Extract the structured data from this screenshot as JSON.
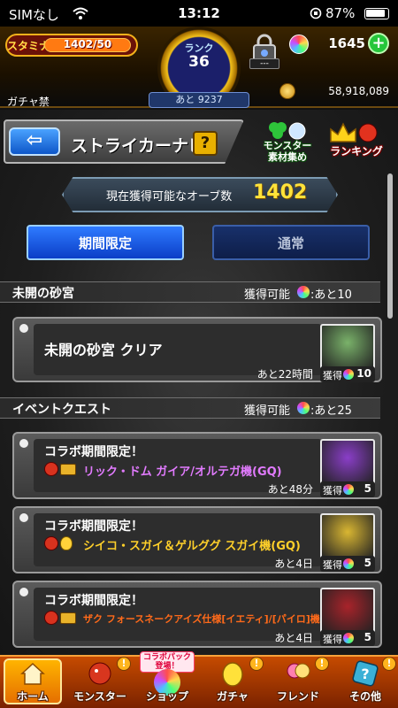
{
  "statusbar": {
    "carrier": "SIMなし",
    "time": "13:12",
    "battery": "87%"
  },
  "header": {
    "stamina_label": "スタミナ",
    "stamina_value": "1402/50",
    "stamina_fill": 1.0,
    "rank_label": "ランク",
    "rank_value": "36",
    "rank_next": "あと 9237",
    "lock_text": "---",
    "orb_count": "1645",
    "gacha_ban": "ガチャ禁",
    "coin_count": "58,918,089"
  },
  "title": {
    "text": "ストライカーナビ",
    "help": "?"
  },
  "shortcuts": {
    "monster_material": [
      "モンスター",
      "素材集め"
    ],
    "ranking": "ランキング"
  },
  "orb_banner": {
    "label": "現在獲得可能なオーブ数",
    "value": "1402"
  },
  "tabs": {
    "limited": "期間限定",
    "normal": "通常"
  },
  "sections": [
    {
      "title": "未開の砂宮",
      "available": "獲得可能",
      "remaining": ":あと10"
    },
    {
      "title": "イベントクエスト",
      "available": "獲得可能",
      "remaining": ":あと25"
    }
  ],
  "cards": [
    {
      "title": "未開の砂宮 クリア",
      "sub": "",
      "time": "あと22時間",
      "reward_label": "獲得",
      "reward": "10",
      "thumb_color": "#7ab26a"
    },
    {
      "title": "コラボ期間限定！",
      "sub": "リック・ドム ガイア/オルテガ機(GQ)",
      "time": "あと48分",
      "reward_label": "獲得",
      "reward": "5",
      "sub_color": "#e27bff",
      "thumb_color": "#8a3ec8"
    },
    {
      "title": "コラボ期間限定！",
      "sub": "シイコ・スガイ＆ゲルググ スガイ機(GQ)",
      "time": "あと4日",
      "reward_label": "獲得",
      "reward": "5",
      "sub_color": "#ffd02a",
      "thumb_color": "#d9b632"
    },
    {
      "title": "コラボ期間限定！",
      "sub": "ザク フォースネークアイズ仕様[イエティ]/[パイロ]機",
      "time": "あと4日",
      "reward_label": "獲得",
      "reward": "5",
      "sub_color": "#ff6a1a",
      "thumb_color": "#a8232a"
    }
  ],
  "nav": {
    "home": "ホーム",
    "monster": "モンスター",
    "shop": "ショップ",
    "collab_pack": "コラボパック登場！",
    "gacha": "ガチャ",
    "friend": "フレンド",
    "other": "その他",
    "badge": "!"
  }
}
